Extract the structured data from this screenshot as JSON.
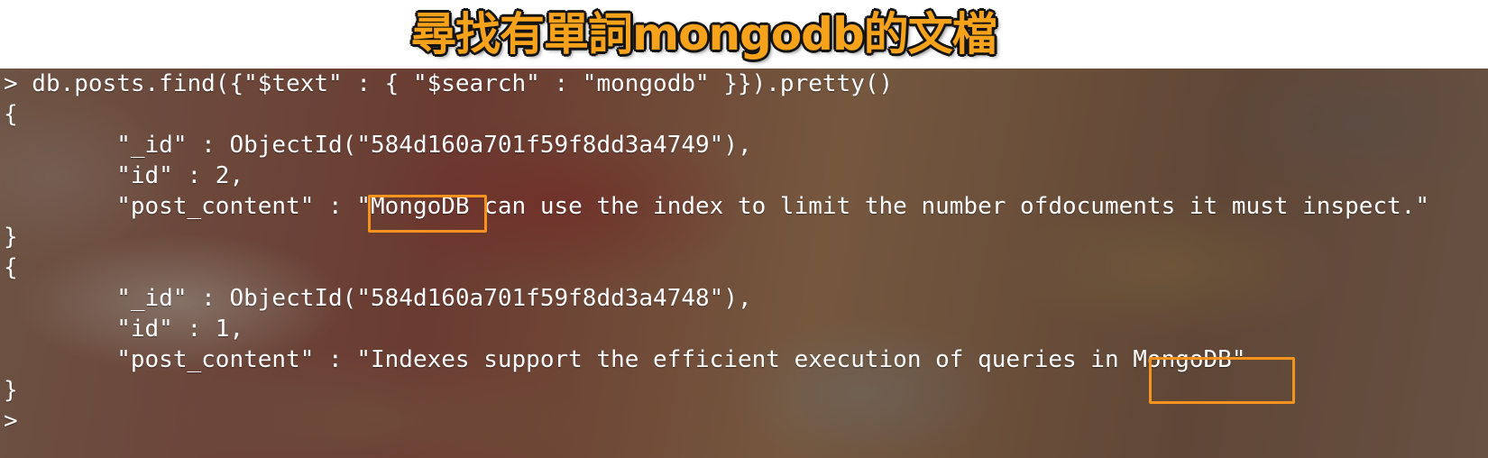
{
  "banner": {
    "title": "尋找有單詞mongodb的文檔"
  },
  "terminal": {
    "lines": [
      "> db.posts.find({\"$text\" : { \"$search\" : \"mongodb\" }}).pretty()",
      "{",
      "        \"_id\" : ObjectId(\"584d160a701f59f8dd3a4749\"),",
      "        \"id\" : 2,",
      "        \"post_content\" : \"MongoDB can use the index to limit the number ofdocuments it must inspect.\"",
      "}",
      "{",
      "        \"_id\" : ObjectId(\"584d160a701f59f8dd3a4748\"),",
      "        \"id\" : 1,",
      "        \"post_content\" : \"Indexes support the efficient execution of queries in MongoDB\"",
      "}",
      ">"
    ]
  },
  "highlight_color": "#f6931f",
  "title_color": "#f7a21b"
}
